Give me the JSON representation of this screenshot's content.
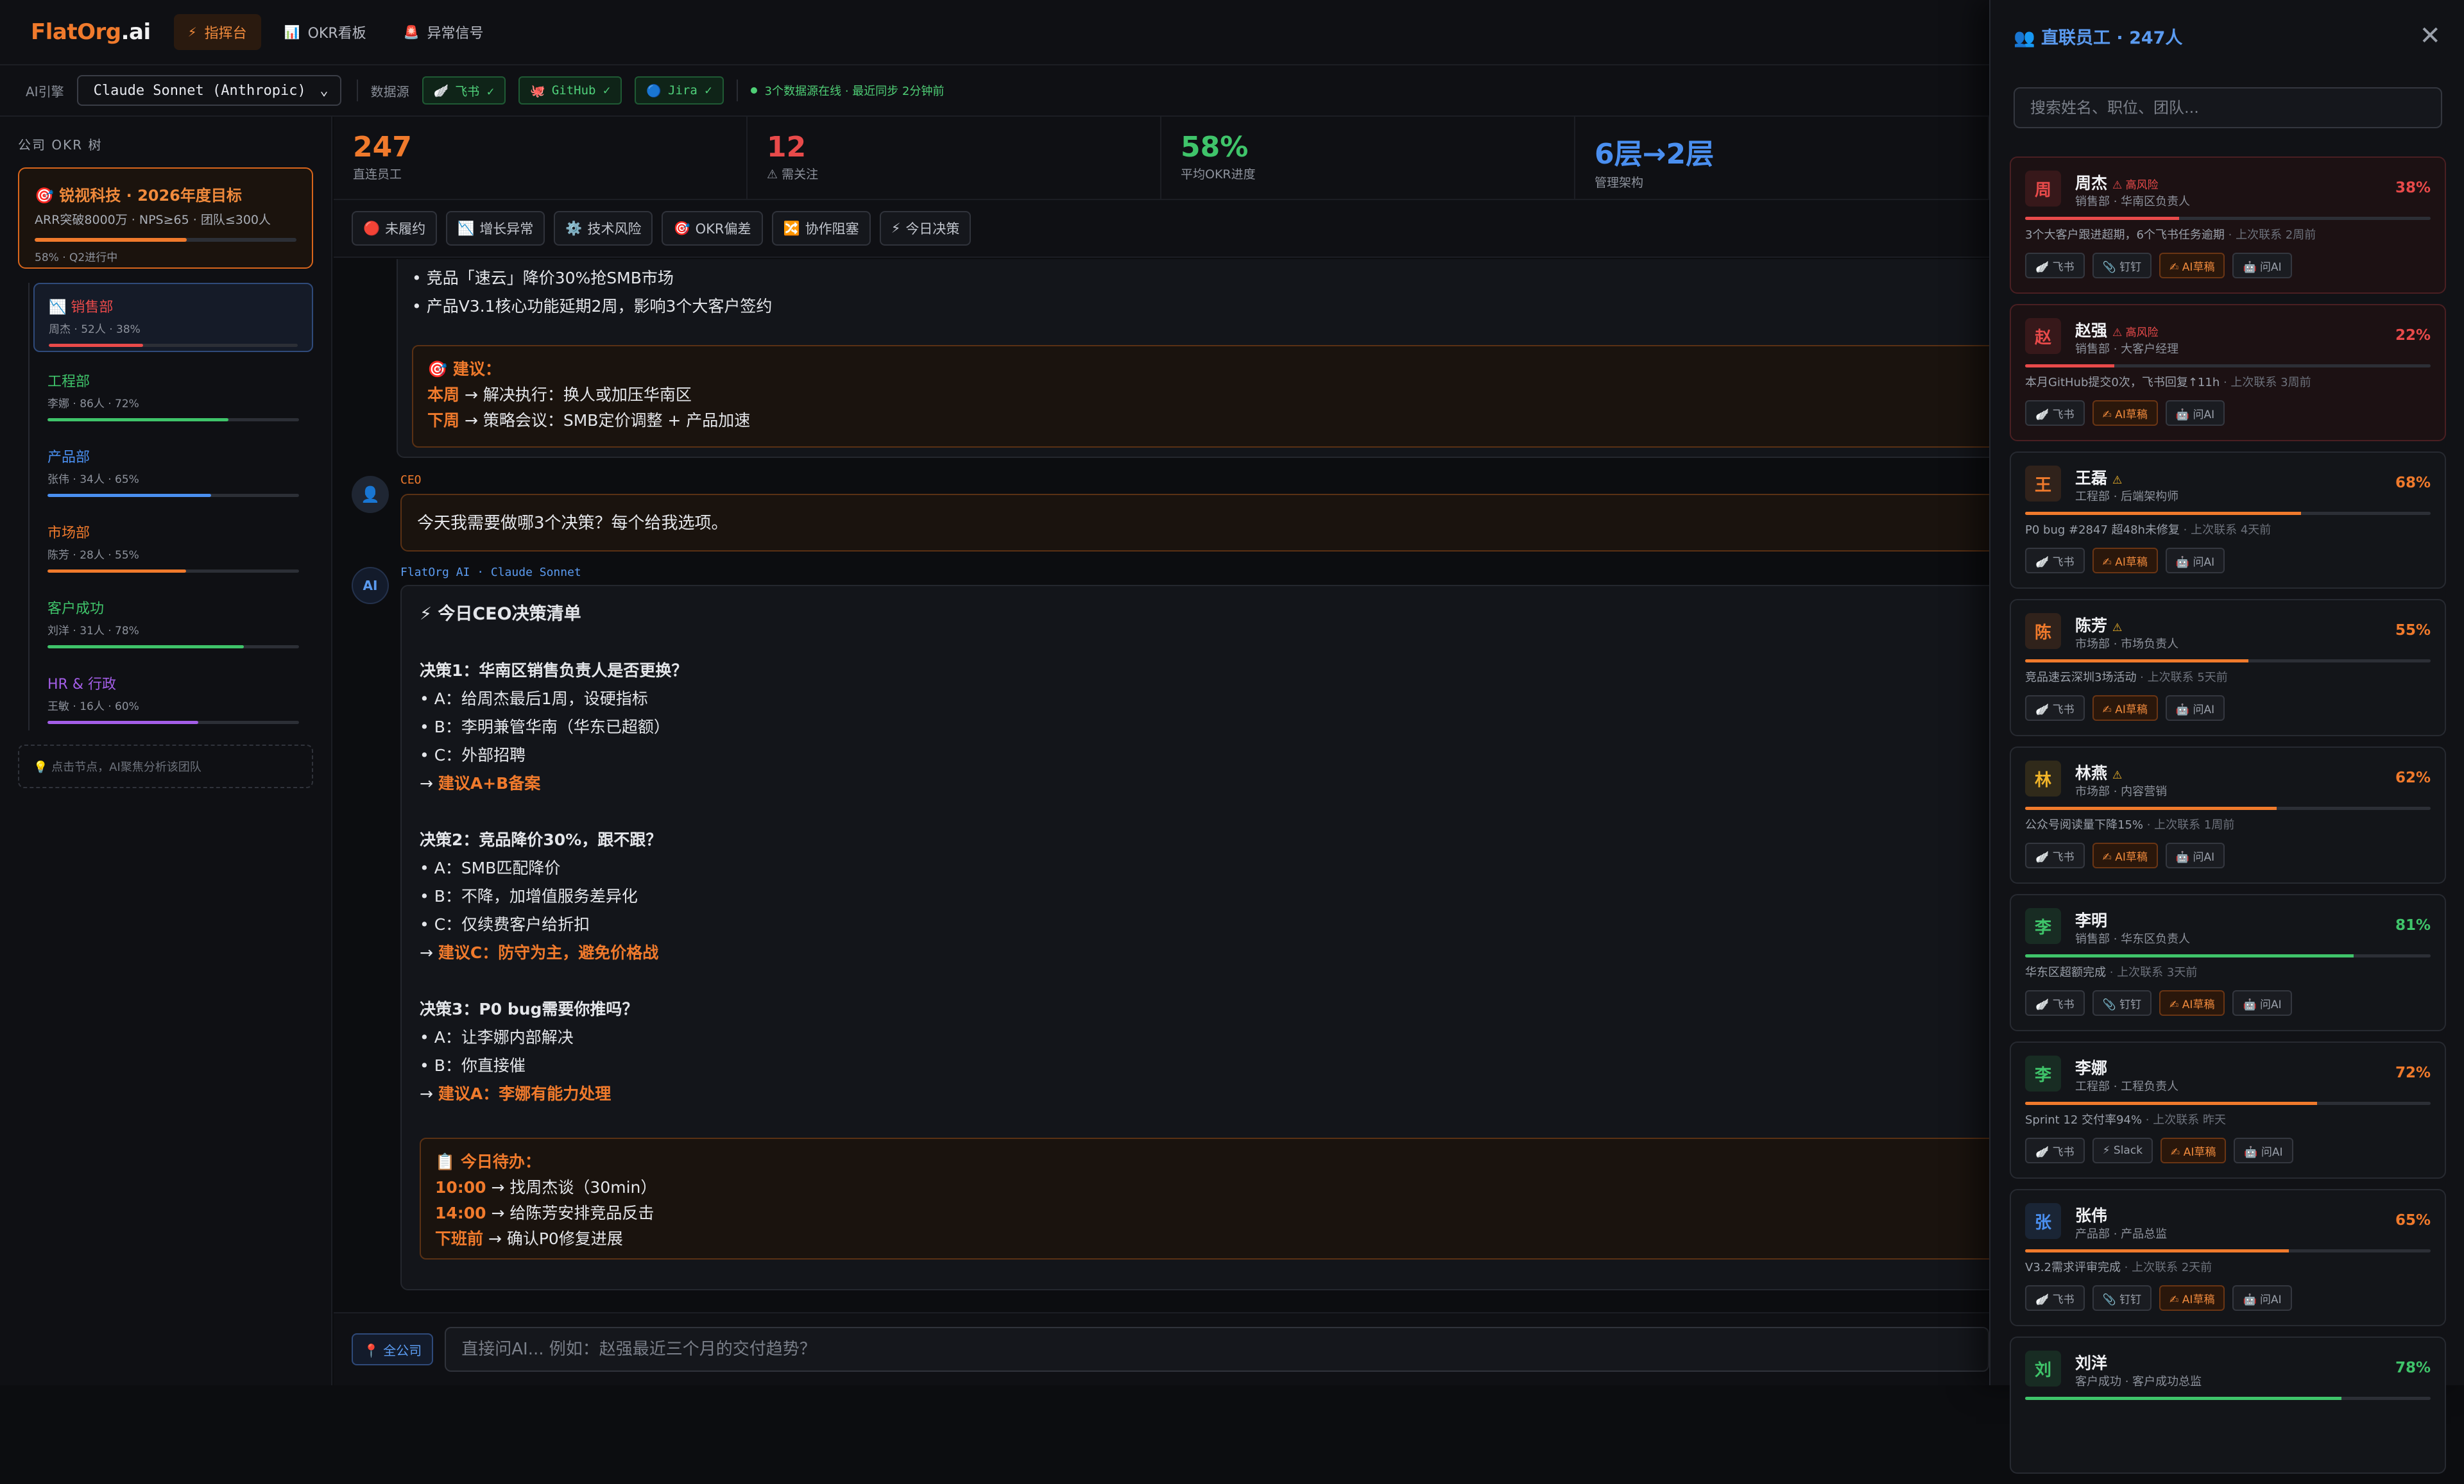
{
  "app": {
    "logo_orange": "FlatOrg",
    "logo_white": ".ai"
  },
  "nav": [
    {
      "icon": "⚡",
      "label": "指挥台",
      "active": true
    },
    {
      "icon": "📊",
      "label": "OKR看板"
    },
    {
      "icon": "🚨",
      "label": "异常信号"
    }
  ],
  "subbar": {
    "ai_label": "AI引擎",
    "ai_engine": "Claude Sonnet (Anthropic)",
    "data_label": "数据源",
    "sources": [
      {
        "icon": "🪽",
        "label": "飞书 ✓"
      },
      {
        "icon": "🐙",
        "label": "GitHub ✓"
      },
      {
        "icon": "🔵",
        "label": "Jira ✓"
      }
    ],
    "status": "3个数据源在线 · 最近同步 2分钟前"
  },
  "sidebar": {
    "title": "公司 OKR 树",
    "company": {
      "title": "🎯 锐视科技 · 2026年度目标",
      "sub": "ARR突破8000万 · NPS≥65 · 团队≤300人",
      "progress": 58,
      "meta": "58% · Q2进行中"
    },
    "departments": [
      {
        "name": "📉 销售部",
        "meta": "周杰 · 52人 · 38%",
        "progress": 38,
        "color": "#e84a4a",
        "selected": true
      },
      {
        "name": "工程部",
        "meta": "李娜 · 86人 · 72%",
        "progress": 72,
        "color": "#3fc46a"
      },
      {
        "name": "产品部",
        "meta": "张伟 · 34人 · 65%",
        "progress": 65,
        "color": "#4a8ff0"
      },
      {
        "name": "市场部",
        "meta": "陈芳 · 28人 · 55%",
        "progress": 55,
        "color": "#f07a2c"
      },
      {
        "name": "客户成功",
        "meta": "刘洋 · 31人 · 78%",
        "progress": 78,
        "color": "#3fc46a"
      },
      {
        "name": "HR & 行政",
        "meta": "王敏 · 16人 · 60%",
        "progress": 60,
        "color": "#a45ee8"
      }
    ],
    "hint": "💡 点击节点，AI聚焦分析该团队"
  },
  "stats": [
    {
      "value": "247",
      "label": "直连员工",
      "color": "#f07a2c"
    },
    {
      "value": "12",
      "label": "⚠ 需关注",
      "color": "#e84a4a"
    },
    {
      "value": "58%",
      "label": "平均OKR进度",
      "color": "#3fc46a"
    },
    {
      "value": "6层→2层",
      "label": "管理架构",
      "color": "#4a8ff0"
    }
  ],
  "filters": [
    {
      "icon": "🔴",
      "label": "未履约"
    },
    {
      "icon": "📉",
      "label": "增长异常"
    },
    {
      "icon": "⚙️",
      "label": "技术风险"
    },
    {
      "icon": "🎯",
      "label": "OKR偏差"
    },
    {
      "icon": "🔀",
      "label": "协作阻塞"
    },
    {
      "icon": "⚡",
      "label": "今日决策"
    }
  ],
  "chat": {
    "prev_lines": [
      "• 竞品「速云」降价30%抢SMB市场",
      "• 产品V3.1核心功能延期2周，影响3个大客户签约"
    ],
    "prev_suggest": {
      "title": "🎯 建议：",
      "items": [
        {
          "when": "本周",
          "text": " → 解决执行：换人或加压华南区"
        },
        {
          "when": "下周",
          "text": " → 策略会议：SMB定价调整 + 产品加速"
        }
      ]
    },
    "user_label": "CEO",
    "user_msg": "今天我需要做哪3个决策？每个给我选项。",
    "ai_label": "FlatOrg AI · Claude Sonnet",
    "ai_title": "⚡ 今日CEO决策清单",
    "decisions": [
      {
        "title": "决策1：华南区销售负责人是否更换？",
        "opts": [
          "• A：给周杰最后1周，设硬指标",
          "• B：李明兼管华南（华东已超额）",
          "• C：外部招聘"
        ],
        "rec": "建议A+B备案"
      },
      {
        "title": "决策2：竞品降价30%，跟不跟？",
        "opts": [
          "• A：SMB匹配降价",
          "• B：不降，加增值服务差异化",
          "• C：仅续费客户给折扣"
        ],
        "rec": "建议C：防守为主，避免价格战"
      },
      {
        "title": "决策3：P0 bug需要你推吗？",
        "opts": [
          "• A：让李娜内部解决",
          "• B：你直接催"
        ],
        "rec": "建议A：李娜有能力处理"
      }
    ],
    "rec_arrow": "→ ",
    "todo": {
      "title": "📋 今日待办：",
      "items": [
        {
          "when": "10:00",
          "text": " → 找周杰谈（30min）"
        },
        {
          "when": "14:00",
          "text": " → 给陈芳安排竞品反击"
        },
        {
          "when": "下班前",
          "text": " → 确认P0修复进展"
        }
      ]
    }
  },
  "input": {
    "scope": "📍 全公司",
    "placeholder": "直接问AI... 例如：赵强最近三个月的交付趋势？"
  },
  "panel": {
    "title": "👥 直联员工 · 247人",
    "close": "✕",
    "search_placeholder": "搜索姓名、职位、团队...",
    "people": [
      {
        "avatar": "周",
        "avatar_color": "#e84a4a",
        "name": "周杰",
        "flag": "⚠ 高风险",
        "flag_type": "risk",
        "role": "销售部 · 华南区负责人",
        "pct": 38,
        "pct_color": "#e84a4a",
        "note": "3个大客户跟进超期，6个飞书任务逾期",
        "last": " · 上次联系 2周前",
        "risk": true,
        "buttons": [
          "🪽 飞书",
          "📎 钉钉",
          "✍ AI草稿",
          "🤖 问AI"
        ]
      },
      {
        "avatar": "赵",
        "avatar_color": "#e84a4a",
        "name": "赵强",
        "flag": "⚠ 高风险",
        "flag_type": "risk",
        "role": "销售部 · 大客户经理",
        "pct": 22,
        "pct_color": "#e84a4a",
        "note": "本月GitHub提交0次，飞书回复↑11h",
        "last": " · 上次联系 3周前",
        "risk": true,
        "buttons": [
          "🪽 飞书",
          "✍ AI草稿",
          "🤖 问AI"
        ]
      },
      {
        "avatar": "王",
        "avatar_color": "#f07a2c",
        "name": "王磊",
        "flag": "⚠",
        "flag_type": "warn",
        "role": "工程部 · 后端架构师",
        "pct": 68,
        "pct_color": "#f07a2c",
        "note": "P0 bug #2847 超48h未修复",
        "last": " · 上次联系 4天前",
        "risk": false,
        "buttons": [
          "🪽 飞书",
          "✍ AI草稿",
          "🤖 问AI"
        ]
      },
      {
        "avatar": "陈",
        "avatar_color": "#f07a2c",
        "name": "陈芳",
        "flag": "⚠",
        "flag_type": "warn",
        "role": "市场部 · 市场负责人",
        "pct": 55,
        "pct_color": "#f07a2c",
        "note": "竞品速云深圳3场活动",
        "last": " · 上次联系 5天前",
        "risk": false,
        "buttons": [
          "🪽 飞书",
          "✍ AI草稿",
          "🤖 问AI"
        ]
      },
      {
        "avatar": "林",
        "avatar_color": "#f0b429",
        "name": "林燕",
        "flag": "⚠",
        "flag_type": "warn",
        "role": "市场部 · 内容营销",
        "pct": 62,
        "pct_color": "#f07a2c",
        "note": "公众号阅读量下降15%",
        "last": " · 上次联系 1周前",
        "risk": false,
        "buttons": [
          "🪽 飞书",
          "✍ AI草稿",
          "🤖 问AI"
        ]
      },
      {
        "avatar": "李",
        "avatar_color": "#3fc46a",
        "name": "李明",
        "flag": "",
        "flag_type": "",
        "role": "销售部 · 华东区负责人",
        "pct": 81,
        "pct_color": "#3fc46a",
        "note": "华东区超额完成",
        "last": " · 上次联系 3天前",
        "risk": false,
        "buttons": [
          "🪽 飞书",
          "📎 钉钉",
          "✍ AI草稿",
          "🤖 问AI"
        ]
      },
      {
        "avatar": "李",
        "avatar_color": "#3fc46a",
        "name": "李娜",
        "flag": "",
        "flag_type": "",
        "role": "工程部 · 工程负责人",
        "pct": 72,
        "pct_color": "#f07a2c",
        "note": "Sprint 12 交付率94%",
        "last": " · 上次联系 昨天",
        "risk": false,
        "buttons": [
          "🪽 飞书",
          "⚡ Slack",
          "✍ AI草稿",
          "🤖 问AI"
        ]
      },
      {
        "avatar": "张",
        "avatar_color": "#4a8ff0",
        "name": "张伟",
        "flag": "",
        "flag_type": "",
        "role": "产品部 · 产品总监",
        "pct": 65,
        "pct_color": "#f07a2c",
        "note": "V3.2需求评审完成",
        "last": " · 上次联系 2天前",
        "risk": false,
        "buttons": [
          "🪽 飞书",
          "📎 钉钉",
          "✍ AI草稿",
          "🤖 问AI"
        ]
      },
      {
        "avatar": "刘",
        "avatar_color": "#3fc46a",
        "name": "刘洋",
        "flag": "",
        "flag_type": "",
        "role": "客户成功 · 客户成功总监",
        "pct": 78,
        "pct_color": "#3fc46a",
        "note": "",
        "last": "",
        "risk": false,
        "buttons": []
      }
    ]
  }
}
